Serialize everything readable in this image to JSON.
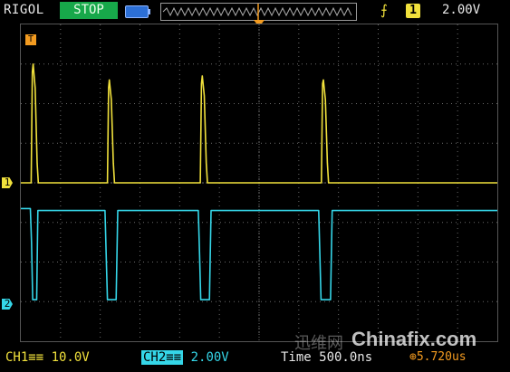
{
  "header": {
    "brand": "RIGOL",
    "run_state": "STOP",
    "trigger": {
      "edge_icon": "rising-edge-icon",
      "source": "1",
      "level": "2.00V"
    }
  },
  "markers": {
    "ch1": "1",
    "ch2": "2",
    "trigger_pos": "T"
  },
  "footer": {
    "ch1_scale": "CH1≡≡ 10.0V",
    "ch2_tag": "CH2≡≡",
    "ch2_scale": "2.00V",
    "timebase": "Time 500.0ns",
    "trigger_offset": "⊕5.720us"
  },
  "watermark": {
    "cn": "迅维网",
    "en": "Chinafix.com"
  },
  "colors": {
    "ch1": "#f1e13c",
    "ch2": "#35d6e8",
    "trigger": "#f39b20",
    "grid": "#6b6b6b",
    "stop_badge": "#17a84a"
  },
  "chart_data": {
    "type": "line",
    "title": "",
    "xlabel": "",
    "ylabel": "",
    "xlim": [
      0,
      12
    ],
    "ylim": [
      -4,
      4
    ],
    "grid": true,
    "series": [
      {
        "name": "CH1",
        "x": [
          0,
          0.26,
          0.29,
          0.31,
          0.36,
          0.41,
          0.44,
          2.18,
          2.21,
          2.23,
          2.28,
          2.33,
          2.36,
          4.52,
          4.55,
          4.57,
          4.62,
          4.67,
          4.7,
          7.57,
          7.6,
          7.62,
          7.67,
          7.72,
          7.75,
          12
        ],
        "y": [
          0,
          0,
          2.8,
          3.0,
          2.4,
          0.5,
          0,
          0,
          2.4,
          2.6,
          2.1,
          0.5,
          0,
          0,
          2.5,
          2.7,
          2.2,
          0.5,
          0,
          0,
          2.5,
          2.6,
          2.1,
          0.5,
          0,
          0
        ]
      },
      {
        "name": "CH2",
        "x": [
          0,
          0.24,
          0.27,
          0.3,
          0.33,
          0.4,
          0.43,
          2.12,
          2.15,
          2.18,
          2.22,
          2.4,
          2.44,
          4.47,
          4.5,
          4.53,
          4.57,
          4.75,
          4.79,
          7.5,
          7.53,
          7.56,
          7.6,
          7.8,
          7.84,
          12
        ],
        "y": [
          -0.65,
          -0.65,
          -1.5,
          -2.95,
          -2.95,
          -2.95,
          -0.7,
          -0.7,
          -1.8,
          -2.95,
          -2.95,
          -2.95,
          -0.7,
          -0.7,
          -1.8,
          -2.95,
          -2.95,
          -2.95,
          -0.7,
          -0.7,
          -1.8,
          -2.95,
          -2.95,
          -2.95,
          -0.7,
          -0.7
        ]
      }
    ]
  }
}
